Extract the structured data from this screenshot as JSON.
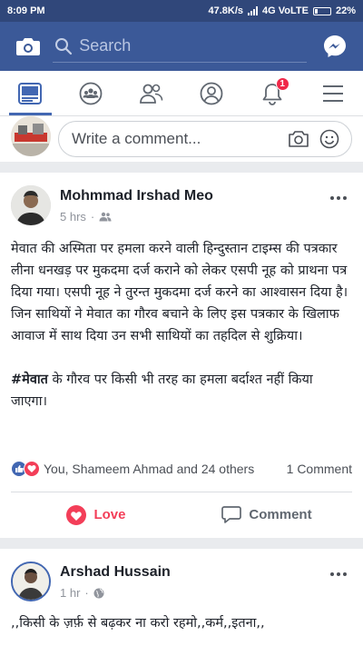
{
  "statusbar": {
    "time": "8:09 PM",
    "speed": "47.8K/s",
    "network": "4G VoLTE",
    "battery": "22%"
  },
  "header": {
    "search_placeholder": "Search"
  },
  "nav": {
    "notification_count": "1"
  },
  "comment_box": {
    "placeholder": "Write a comment..."
  },
  "posts": [
    {
      "author": "Mohmmad Irshad Meo",
      "time": "5 hrs",
      "audience_icon": "friends-icon",
      "paragraphs": [
        "मेवात की अस्मिता पर हमला करने वाली हिन्दुस्तान टाइम्स की पत्रकार लीना धनखड़ पर मुकदमा दर्ज कराने को लेकर एसपी नूह को प्राथना पत्र दिया गया। एसपी नूह ने तुरन्त मुकदमा दर्ज करने का आश्वासन दिया है।",
        "जिन साथियों ने मेवात का गौरव बचाने के लिए इस पत्रकार के खिलाफ आवाज में साथ दिया उन सभी साथियों का तहदिल से शुक्रिया।"
      ],
      "hashtag": "#मेवात",
      "hashtag_rest": " के गौरव पर किसी भी तरह का हमला बर्दाश्त नहीं किया जाएगा।",
      "reactions_text": "You, Shameem Ahmad and 24 others",
      "comments_count": "1 Comment",
      "love_label": "Love",
      "comment_label": "Comment"
    },
    {
      "author": "Arshad Hussain",
      "time": "1 hr",
      "audience_icon": "globe-icon",
      "text": ",,किसी के ज़र्फ़ से बढ़कर ना करो रहमो,,कर्म,,इतना,,"
    }
  ],
  "colors": {
    "brand": "#3b5998",
    "love": "#f33e58",
    "like": "#4267b2"
  }
}
